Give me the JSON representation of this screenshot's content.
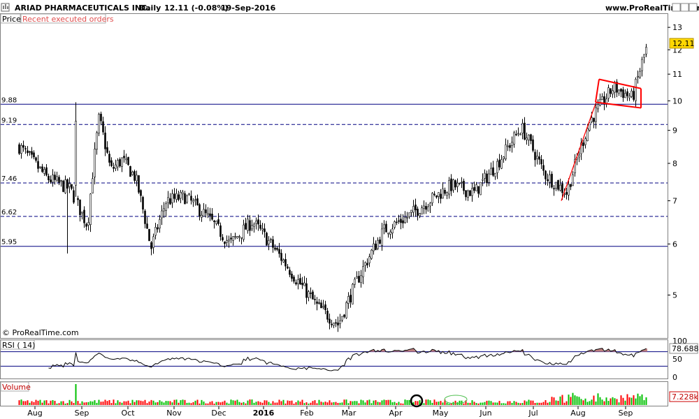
{
  "header": {
    "ticker": "ARIAD PHARMACEUTICALS INC.",
    "period": "Daily",
    "quote": "12.11 (-0.08%)",
    "date": "19-Sep-2016",
    "site": "www.ProRealTime.com"
  },
  "price_panel": {
    "label": "Price",
    "recent_orders_label": "Recent executed orders",
    "copyright": "© ProRealTime.com",
    "last_price_label": "12.11"
  },
  "rsi_panel": {
    "label": "RSI ( 14)",
    "value_label": "78.688"
  },
  "volume_panel": {
    "label": "Volume",
    "value_label": "7.228k"
  },
  "colors": {
    "border": "#808080",
    "candle": "#000000",
    "level_line": "#000080",
    "trend_line": "#ff0000",
    "last_price_box": "#ffd700",
    "volume_up": "#00c000",
    "volume_down": "#ff0000",
    "rsi_overbought_fill": "#c08080",
    "annotation_circle": "#000000",
    "annotation_ellipse": "#50c050"
  },
  "chart_data": [
    {
      "type": "candlestick",
      "scale": "log",
      "ylim": [
        4.3,
        13.3
      ],
      "y_ticks": [
        "5",
        "6",
        "7",
        "8",
        "9",
        "10",
        "11",
        "12",
        "13"
      ],
      "x_ticks": [
        "Aug",
        "Sep",
        "Oct",
        "Nov",
        "Dec",
        "2016",
        "Feb",
        "Mar",
        "Apr",
        "May",
        "Jun",
        "Jul",
        "Aug",
        "Sep"
      ],
      "last_price": 12.11,
      "levels": [
        {
          "label": "9.88",
          "value": 9.88,
          "style": "solid"
        },
        {
          "label": "9.19",
          "value": 9.19,
          "style": "dashed"
        },
        {
          "label": "7.46",
          "value": 7.46,
          "style": "dashed"
        },
        {
          "label": "6.62",
          "value": 6.62,
          "style": "dashed"
        },
        {
          "label": "5.95",
          "value": 5.95,
          "style": "solid"
        }
      ],
      "trend_lines": [
        {
          "from": [
            "Jul-2016",
            7.0
          ],
          "to": [
            "Aug-2016",
            9.9
          ]
        }
      ],
      "flag_channel": {
        "upper": [
          [
            "Aug-2016",
            10.8
          ],
          [
            "Sep-2016",
            10.45
          ]
        ],
        "lower": [
          [
            "Aug-2016",
            9.95
          ],
          [
            "Sep-2016",
            9.75
          ]
        ]
      },
      "close_path": [
        {
          "x": "Jul-2015",
          "close": 8.5
        },
        {
          "x": "Aug-2015",
          "close": 7.6
        },
        {
          "x": "Aug-2015",
          "close": 7.3
        },
        {
          "x": "Sep-2015",
          "close": 6.4
        },
        {
          "x": "Sep-2015",
          "close": 9.4
        },
        {
          "x": "Sep-2015",
          "close": 7.8
        },
        {
          "x": "Sep-2015",
          "close": 8.1
        },
        {
          "x": "Oct-2015",
          "close": 7.6
        },
        {
          "x": "Oct-2015",
          "close": 5.9
        },
        {
          "x": "Oct-2015",
          "close": 7.0
        },
        {
          "x": "Nov-2015",
          "close": 7.1
        },
        {
          "x": "Nov-2015",
          "close": 6.6
        },
        {
          "x": "Dec-2015",
          "close": 6.0
        },
        {
          "x": "Dec-2015",
          "close": 6.5
        },
        {
          "x": "Jan-2016",
          "close": 5.9
        },
        {
          "x": "Jan-2016",
          "close": 5.3
        },
        {
          "x": "Feb-2016",
          "close": 4.8
        },
        {
          "x": "Feb-2016",
          "close": 4.5
        },
        {
          "x": "Mar-2016",
          "close": 5.4
        },
        {
          "x": "Mar-2016",
          "close": 6.3
        },
        {
          "x": "Apr-2016",
          "close": 6.6
        },
        {
          "x": "Apr-2016",
          "close": 7.0
        },
        {
          "x": "May-2016",
          "close": 7.4
        },
        {
          "x": "May-2016",
          "close": 7.2
        },
        {
          "x": "Jun-2016",
          "close": 8.0
        },
        {
          "x": "Jun-2016",
          "close": 9.1
        },
        {
          "x": "Jul-2016",
          "close": 7.7
        },
        {
          "x": "Jul-2016",
          "close": 7.2
        },
        {
          "x": "Aug-2016",
          "close": 9.3
        },
        {
          "x": "Aug-2016",
          "close": 10.5
        },
        {
          "x": "Sep-2016",
          "close": 10.1
        },
        {
          "x": "Sep-2016",
          "close": 12.11
        }
      ]
    },
    {
      "type": "line",
      "title": "RSI ( 14)",
      "ylim": [
        0,
        100
      ],
      "y_ticks": [
        "0",
        "50",
        "100"
      ],
      "reference_levels": [
        30,
        70
      ],
      "last_value": 78.688
    },
    {
      "type": "bar",
      "title": "Volume",
      "last_value": "7.228k"
    }
  ]
}
